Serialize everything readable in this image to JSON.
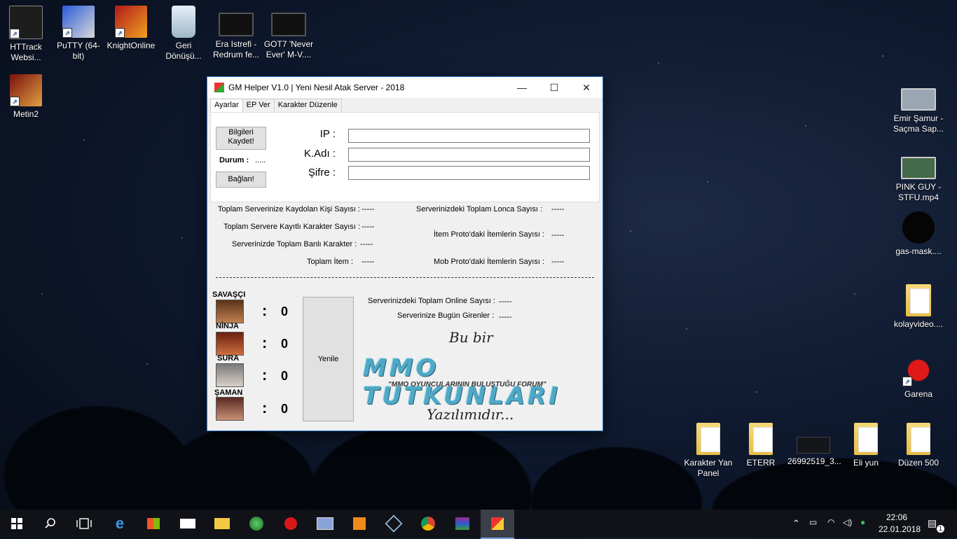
{
  "desktop": {
    "icons_left": [
      {
        "label": "HTTrack Websi..."
      },
      {
        "label": "PuTTY (64-bit)"
      },
      {
        "label": "KnightOnline"
      },
      {
        "label": "Geri Dönüşü..."
      },
      {
        "label": "Era Istrefi - Redrum fe..."
      },
      {
        "label": "GOT7 'Never Ever' M-V...."
      },
      {
        "label": "Metin2"
      }
    ],
    "icons_right": [
      {
        "label": "Emir Şamur - Saçma Sap..."
      },
      {
        "label": "PINK GUY - STFU.mp4"
      },
      {
        "label": "gas-mask...."
      },
      {
        "label": "kolayvideo...."
      },
      {
        "label": "Garena"
      }
    ],
    "icons_bottom": [
      {
        "label": "Karakter Yan Panel"
      },
      {
        "label": "ETERR"
      },
      {
        "label": "26992519_3..."
      },
      {
        "label": "Eli yun"
      },
      {
        "label": "Düzen 500"
      }
    ]
  },
  "window": {
    "title": "GM Helper V1.0 | Yeni Nesil Atak Server - 2018",
    "minimize": "—",
    "maximize": "☐",
    "close": "✕",
    "tabs": [
      {
        "label": "Ayarlar",
        "active": true
      },
      {
        "label": "EP Ver",
        "active": false
      },
      {
        "label": "Karakter Düzenle",
        "active": false
      }
    ],
    "settings": {
      "save_button": "Bilgileri Kaydet!",
      "status_label": "Durum :",
      "status_value": ".....",
      "connect_button": "Bağlan!",
      "ip_label": "IP :",
      "user_label": "K.Adı :",
      "password_label": "Şifre :",
      "ip_value": "",
      "user_value": "",
      "password_value": ""
    },
    "stats": {
      "registered_users_label": "Toplam Serverinize Kaydolan Kişi Sayısı :",
      "registered_users_value": "-----",
      "characters_label": "Toplam Servere Kayıtlı Karakter Sayısı :",
      "characters_value": "-----",
      "banned_label": "Serverinizde Toplam Banlı Karakter :",
      "banned_value": "-----",
      "items_label": "Toplam İtem :",
      "items_value": "-----",
      "guilds_label": "Serverinizdeki Toplam Lonca Sayısı :",
      "guilds_value": "-----",
      "item_proto_label": "İtem Proto'daki İtemlerin Sayısı :",
      "item_proto_value": "-----",
      "mob_proto_label": "Mob Proto'daki İtemlerin Sayısı :",
      "mob_proto_value": "-----",
      "online_label": "Serverinizdeki Toplam Online Sayısı :",
      "online_value": "-----",
      "today_label": "Serverinize Bugün Girenler :",
      "today_value": "-----"
    },
    "classes": [
      {
        "name": "SAVAŞÇI",
        "colon": ":",
        "count": "0"
      },
      {
        "name": "NİNJA",
        "colon": ":",
        "count": "0"
      },
      {
        "name": "SURA",
        "colon": ":",
        "count": "0"
      },
      {
        "name": "ŞAMAN",
        "colon": ":",
        "count": "0"
      }
    ],
    "refresh_button": "Yenile",
    "logo": {
      "top": "Bu bir",
      "main": "MMO TUTKUNLARI",
      "tagline": "\"MMO OYUNCULARININ BULUŞTUĞU FORUM\"",
      "bottom": "Yazılımıdır..."
    }
  },
  "taskbar": {
    "time": "22:06",
    "date": "22.01.2018",
    "notification_count": "1"
  },
  "colors": {
    "window_border": "#2d7fd3",
    "taskbar": "#101217",
    "logo_accent": "#4fa9c6"
  }
}
